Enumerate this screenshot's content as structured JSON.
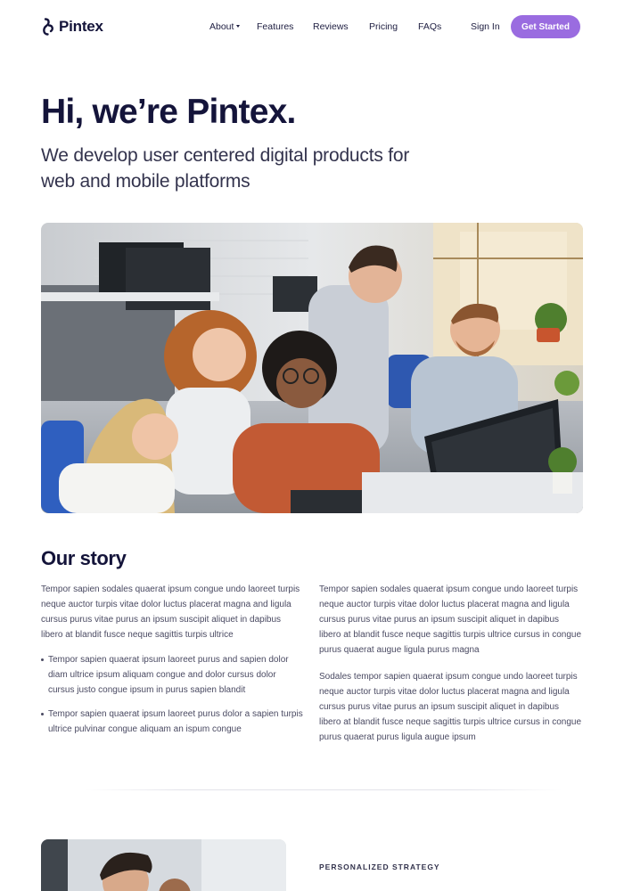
{
  "brand": {
    "name": "Pintex",
    "logo_icon": "pintex-logo-mark",
    "accent": "#9a6ce0",
    "ink": "#14143a"
  },
  "nav": {
    "items": [
      {
        "label": "About",
        "has_dropdown": true
      },
      {
        "label": "Features"
      },
      {
        "label": "Reviews"
      },
      {
        "label": "Pricing"
      },
      {
        "label": "FAQs"
      }
    ],
    "sign_in": "Sign In",
    "cta": "Get Started",
    "dropdown_icon": "chevron-down-icon"
  },
  "hero": {
    "title": "Hi, we’re Pintex.",
    "subtitle": "We develop user centered digital products for web and mobile platforms",
    "image_alt_icon": "team-photo"
  },
  "story": {
    "title": "Our story",
    "left_paragraph": "Tempor sapien sodales quaerat ipsum congue undo laoreet turpis neque auctor turpis vitae dolor luctus placerat magna and ligula cursus purus vitae purus an ipsum suscipit aliquet in dapibus libero at blandit fusce neque sagittis turpis ultrice",
    "bullets": [
      "Tempor sapien quaerat ipsum laoreet purus and sapien dolor diam ultrice ipsum aliquam congue and dolor cursus dolor cursus justo congue ipsum in purus sapien blandit",
      "Tempor sapien quaerat ipsum laoreet purus dolor a sapien turpis ultrice pulvinar congue aliquam an ispum congue"
    ],
    "right_paragraphs": [
      "Tempor sapien sodales quaerat ipsum congue undo laoreet turpis neque auctor turpis vitae dolor luctus placerat magna and ligula cursus purus vitae purus an ipsum suscipit aliquet in dapibus libero at blandit fusce neque sagittis turpis ultrice cursus in congue purus quaerat augue ligula purus magna",
      "Sodales tempor sapien quaerat ipsum congue undo laoreet turpis neque auctor turpis vitae dolor luctus placerat magna and ligula cursus purus vitae purus an ipsum suscipit aliquet in dapibus libero at blandit fusce neque sagittis turpis ultrice cursus in congue purus quaerat purus ligula augue ipsum"
    ]
  },
  "strategy": {
    "eyebrow": "PERSONALIZED STRATEGY"
  }
}
